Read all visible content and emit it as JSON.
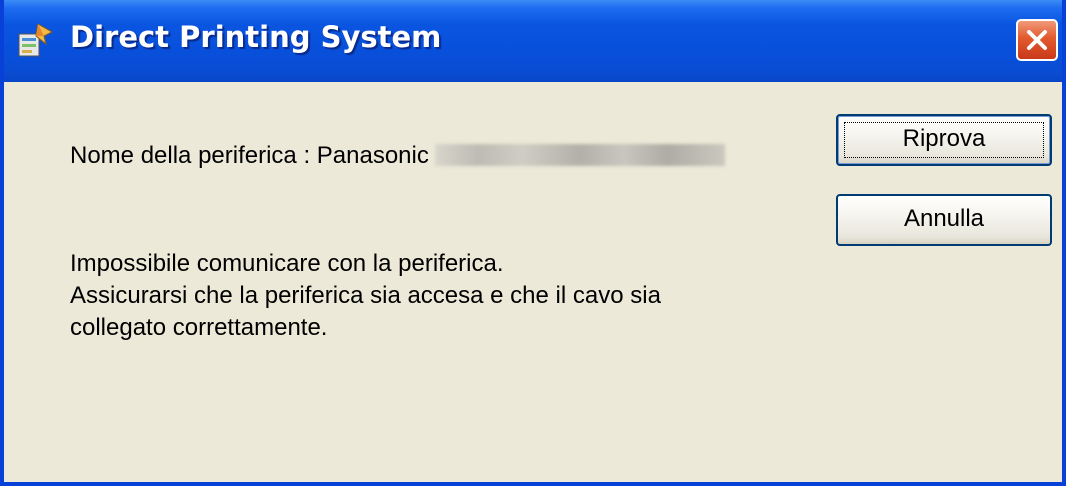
{
  "window": {
    "title": "Direct Printing System"
  },
  "dialog": {
    "device_label": "Nome della periferica : Panasonic",
    "device_name_redacted": "",
    "message_lines": [
      "Impossibile comunicare con la periferica.",
      "Assicurarsi che la periferica sia accesa e che il cavo sia",
      "collegato correttamente."
    ]
  },
  "buttons": {
    "retry_label": "Riprova",
    "cancel_label": "Annulla"
  },
  "colors": {
    "titlebar": "#0a55e0",
    "dialog_bg": "#ece9d8",
    "close_button": "#e25a2e"
  },
  "icons": {
    "app": "direct-printing-app-icon",
    "close": "close-x-icon"
  }
}
